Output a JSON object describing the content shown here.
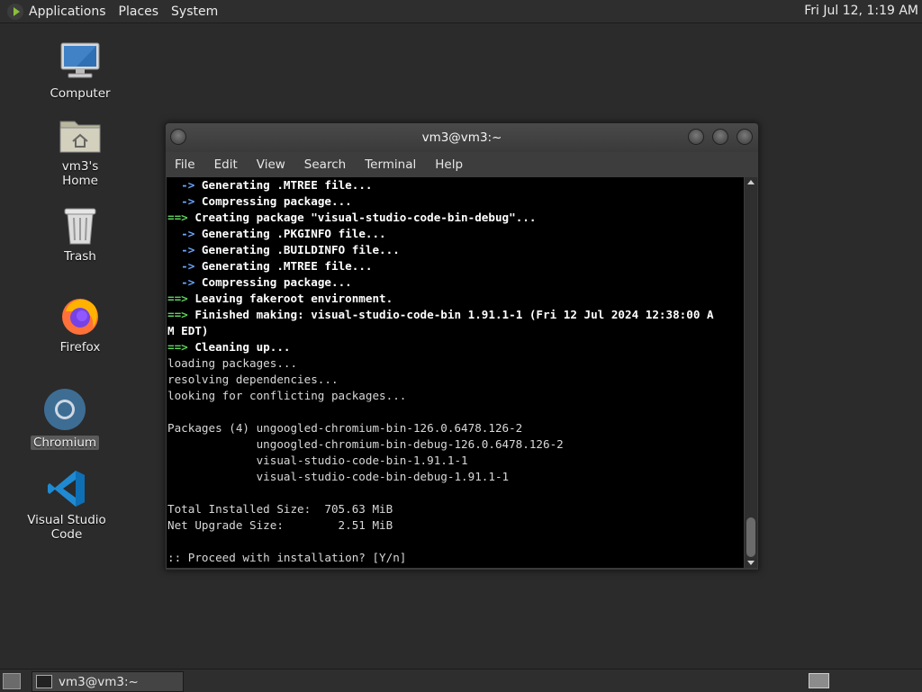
{
  "top_panel": {
    "menus": [
      "Applications",
      "Places",
      "System"
    ],
    "clock": "Fri Jul 12,  1:19 AM"
  },
  "desktop": {
    "icons": [
      {
        "label": "Computer"
      },
      {
        "label": "vm3's Home"
      },
      {
        "label": "Trash"
      },
      {
        "label": "Firefox"
      },
      {
        "label": "Chromium"
      },
      {
        "label": "Visual Studio Code"
      }
    ]
  },
  "terminal": {
    "title": "vm3@vm3:~",
    "menus": [
      "File",
      "Edit",
      "View",
      "Search",
      "Terminal",
      "Help"
    ],
    "lines": [
      "  -> Generating .MTREE file...",
      "  -> Compressing package...",
      "==> Creating package \"visual-studio-code-bin-debug\"...",
      "  -> Generating .PKGINFO file...",
      "  -> Generating .BUILDINFO file...",
      "  -> Generating .MTREE file...",
      "  -> Compressing package...",
      "==> Leaving fakeroot environment.",
      "==> Finished making: visual-studio-code-bin 1.91.1-1 (Fri 12 Jul 2024 12:38:00 A",
      "M EDT)",
      "==> Cleaning up...",
      "loading packages...",
      "resolving dependencies...",
      "looking for conflicting packages...",
      "",
      "Packages (4) ungoogled-chromium-bin-126.0.6478.126-2",
      "             ungoogled-chromium-bin-debug-126.0.6478.126-2",
      "             visual-studio-code-bin-1.91.1-1",
      "             visual-studio-code-bin-debug-1.91.1-1",
      "",
      "Total Installed Size:  705.63 MiB",
      "Net Upgrade Size:        2.51 MiB",
      "",
      ":: Proceed with installation? [Y/n] "
    ]
  },
  "taskbar": {
    "task_label": "vm3@vm3:~"
  },
  "colors": {
    "desktop_bg": "#2b2b2b",
    "term_bg": "#000000",
    "arrow_blue": "#6aa8ff",
    "arrow_green": "#5fd25f"
  }
}
